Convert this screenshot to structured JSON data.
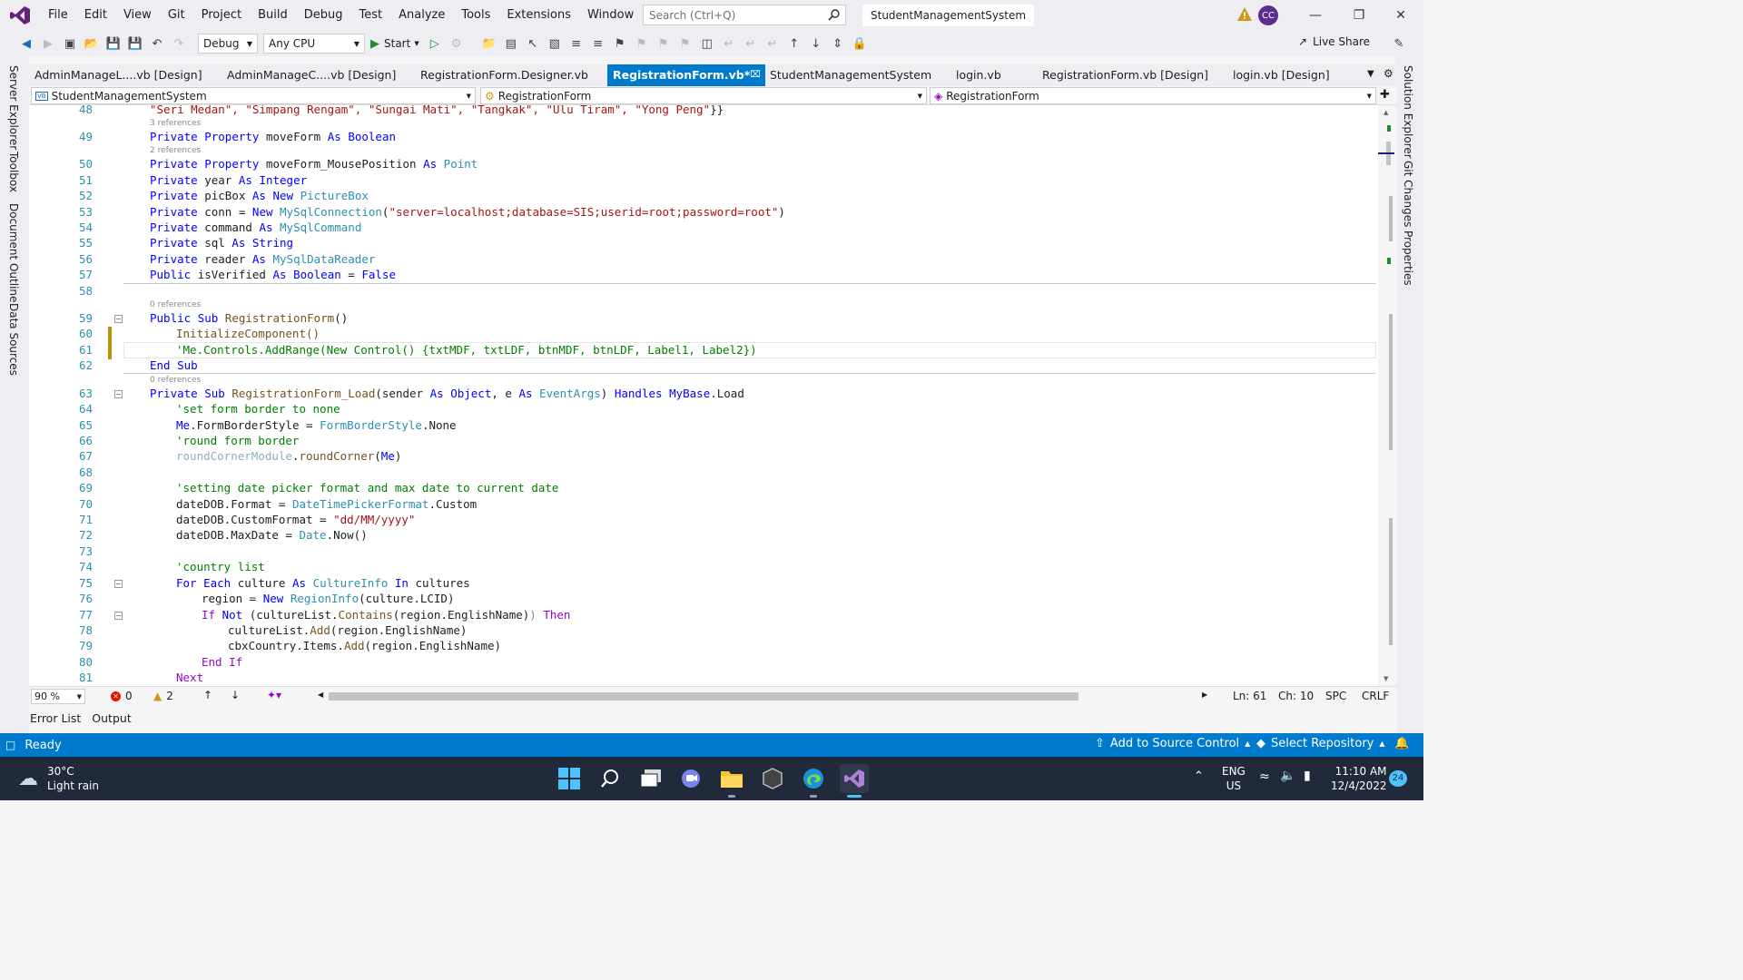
{
  "menu": [
    "File",
    "Edit",
    "View",
    "Git",
    "Project",
    "Build",
    "Debug",
    "Test",
    "Analyze",
    "Tools",
    "Extensions",
    "Window",
    "Help"
  ],
  "search": {
    "placeholder": "Search (Ctrl+Q)"
  },
  "solution_name": "StudentManagementSystem",
  "user_initials": "CC",
  "toolbar": {
    "config": "Debug",
    "platform": "Any CPU",
    "start_label": "Start",
    "live_share": "Live Share"
  },
  "left_dock": [
    "Server Explorer",
    "Toolbox",
    "Document Outline",
    "Data Sources"
  ],
  "right_dock": [
    "Solution Explorer",
    "Git Changes",
    "Properties"
  ],
  "doc_tabs": [
    "AdminManageL....vb [Design]",
    "AdminManageC....vb [Design]",
    "RegistrationForm.Designer.vb",
    "RegistrationForm.vb*",
    "StudentManagementSystem",
    "login.vb",
    "RegistrationForm.vb [Design]",
    "login.vb [Design]"
  ],
  "nav": {
    "project": "StudentManagementSystem",
    "class": "RegistrationForm",
    "member": "RegistrationForm"
  },
  "code": {
    "line_numbers": [
      "48",
      "49",
      "50",
      "51",
      "52",
      "53",
      "54",
      "55",
      "56",
      "57",
      "58",
      "59",
      "60",
      "61",
      "62",
      "63",
      "64",
      "65",
      "66",
      "67",
      "68",
      "69",
      "70",
      "71",
      "72",
      "73",
      "74",
      "75",
      "76",
      "77",
      "78",
      "79",
      "80",
      "81"
    ],
    "refs": {
      "r49": "3 references",
      "r50": "2 references",
      "r59": "0 references",
      "r63": "0 references"
    },
    "l48a": "\"Seri Medan\", \"Simpang Rengam\", \"Sungai Mati\", \"Tangkak\", \"Ulu Tiram\", \"Yong Peng\"",
    "l48b": "}}",
    "l49": [
      "Private",
      "Property",
      "moveForm",
      "As",
      "Boolean"
    ],
    "l50": [
      "Private",
      "Property",
      "moveForm_MousePosition",
      "As",
      "Point"
    ],
    "l51": [
      "Private",
      "year",
      "As",
      "Integer"
    ],
    "l52": [
      "Private",
      "picBox",
      "As",
      "New",
      "PictureBox"
    ],
    "l53": [
      "Private",
      "conn",
      "=",
      "New",
      "MySqlConnection",
      "(",
      "\"server=localhost;database=SIS;userid=root;password=root\"",
      ")"
    ],
    "l54": [
      "Private",
      "command",
      "As",
      "MySqlCommand"
    ],
    "l55": [
      "Private",
      "sql",
      "As",
      "String"
    ],
    "l56": [
      "Private",
      "reader",
      "As",
      "MySqlDataReader"
    ],
    "l57": [
      "Public",
      "isVerified",
      "As",
      "Boolean",
      "=",
      "False"
    ],
    "l59": [
      "Public",
      "Sub",
      "RegistrationForm",
      "()"
    ],
    "l60": "InitializeComponent()",
    "l61": "'Me.Controls.AddRange(New Control() {txtMDF, txtLDF, btnMDF, btnLDF, Label1, Label2})",
    "l62": "End Sub",
    "l63": [
      "Private",
      "Sub",
      "RegistrationForm_Load",
      "(sender",
      "As",
      "Object",
      ", e",
      "As",
      "EventArgs",
      ")",
      "Handles",
      "MyBase",
      ".Load"
    ],
    "l64": "'set form border to none",
    "l65": [
      "Me",
      ".FormBorderStyle = ",
      "FormBorderStyle",
      ".None"
    ],
    "l66": "'round form border",
    "l67": [
      "roundCornerModule",
      ".",
      "roundCorner",
      "(",
      "Me",
      ")"
    ],
    "l69": "'setting date picker format and max date to current date",
    "l70": [
      "dateDOB.Format = ",
      "DateTimePickerFormat",
      ".Custom"
    ],
    "l71": [
      "dateDOB.CustomFormat = ",
      "\"dd/MM/yyyy\""
    ],
    "l72": [
      "dateDOB.MaxDate = ",
      "Date",
      ".Now()"
    ],
    "l74": "'country list",
    "l75": [
      "For",
      "Each",
      "culture",
      "As",
      "CultureInfo",
      "In",
      "cultures"
    ],
    "l76": [
      "region = ",
      "New",
      "RegionInfo",
      "(culture.LCID)"
    ],
    "l77": [
      "If",
      "Not",
      "(cultureList.",
      "Contains",
      "(region.EnglishName)",
      ")",
      "Then"
    ],
    "l78": [
      "cultureList.",
      "Add",
      "(region.EnglishName)"
    ],
    "l79": [
      "cbxCountry.Items.",
      "Add",
      "(region.EnglishName)"
    ],
    "l80": "End If",
    "l81": "Next"
  },
  "editor_status": {
    "zoom": "90 %",
    "errors": "0",
    "warnings": "2",
    "ln": "Ln: 61",
    "ch": "Ch: 10",
    "spc": "SPC",
    "eol": "CRLF"
  },
  "bottom_tabs": [
    "Error List",
    "Output"
  ],
  "status": {
    "ready": "Ready",
    "source_control": "Add to Source Control",
    "repository": "Select Repository"
  },
  "taskbar": {
    "temp": "30°C",
    "weather": "Light rain",
    "lang": "ENG",
    "region": "US",
    "time": "11:10 AM",
    "date": "12/4/2022",
    "notif_count": "24"
  },
  "colors": {
    "accent": "#007acc",
    "vs_purple": "#68217a",
    "keyword": "#0000ff",
    "type": "#2b91af",
    "string": "#a31515",
    "comment": "#008000"
  }
}
